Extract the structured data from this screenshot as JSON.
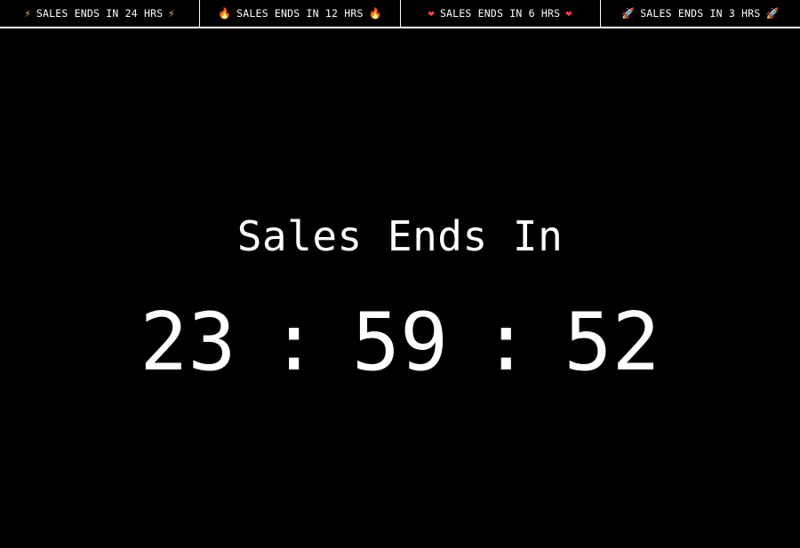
{
  "tabs": [
    {
      "label": "SALES ENDS IN 24 HRS",
      "icon": "lightning-icon",
      "glyph": "⚡"
    },
    {
      "label": "SALES ENDS IN 12 HRS",
      "icon": "fire-icon",
      "glyph": "🔥"
    },
    {
      "label": "SALES ENDS IN 6 HRS",
      "icon": "heart-on-fire-icon",
      "glyph": "❤"
    },
    {
      "label": "SALES ENDS IN 3 HRS",
      "icon": "rocket-icon",
      "glyph": "🚀"
    }
  ],
  "headline": "Sales Ends In",
  "timer": {
    "hours": "23",
    "minutes": "59",
    "seconds": "52",
    "separator": ":"
  },
  "colors": {
    "background": "#000000",
    "text": "#ffffff"
  }
}
